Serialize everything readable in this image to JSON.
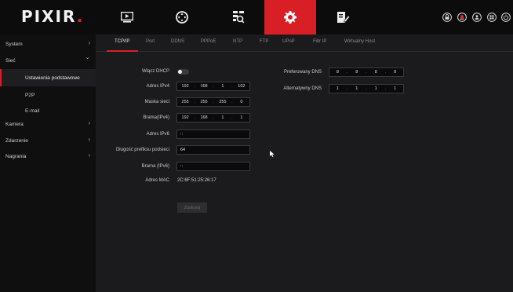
{
  "app": {
    "logo_main": "PIXIR",
    "logo_dot": "."
  },
  "topnav": {
    "items": [
      {
        "icon": "playback-icon"
      },
      {
        "icon": "ptz-icon"
      },
      {
        "icon": "search-icon"
      },
      {
        "icon": "settings-icon",
        "active": true
      },
      {
        "icon": "edit-icon"
      }
    ],
    "right_icons": [
      "lock-icon",
      "alarm-icon",
      "user-icon",
      "grid-icon",
      "power-icon"
    ],
    "accent_color": "#d81f26"
  },
  "sidebar": {
    "items": [
      {
        "label": "System",
        "arrow": "›"
      },
      {
        "label": "Sieć",
        "arrow": "⌄"
      },
      {
        "label": "Ustawienia podstawowe"
      },
      {
        "label": "P2P"
      },
      {
        "label": "E-mail"
      },
      {
        "label": "Kamera",
        "arrow": "›"
      },
      {
        "label": "Zdarzenie",
        "arrow": "›"
      },
      {
        "label": "Nagrania",
        "arrow": "›"
      }
    ]
  },
  "tabs": [
    "TCP/IP",
    "Port",
    "DDNS",
    "PPPoE",
    "NTP",
    "FTP",
    "UPnP",
    "Filtr IP",
    "Wirtualny Host"
  ],
  "form": {
    "dhcp_label": "Włącz DHCP",
    "ipv4_label": "Adres IPv4",
    "ipv4": [
      "192",
      "168",
      "1",
      "102"
    ],
    "mask_label": "Maska sieci",
    "mask": [
      "255",
      "255",
      "255",
      "0"
    ],
    "gateway_label": "Brama(IPv4)",
    "gateway": [
      "192",
      "168",
      "1",
      "1"
    ],
    "ipv6_label": "Adres IPv6",
    "ipv6": "::",
    "prefix_label": "Długość prefiksu podsieci",
    "prefix": "64",
    "gateway6_label": "Brama (IPv6)",
    "gateway6": "::",
    "mac_label": "Adres MAC",
    "mac": "2C:6F:51:25:26:17",
    "dns1_label": "Preferowany DNS",
    "dns1": [
      "8",
      "8",
      "8",
      "8"
    ],
    "dns2_label": "Alternatywny DNS",
    "dns2": [
      "1",
      "1",
      "1",
      "1"
    ],
    "save_label": "Zastosuj"
  }
}
